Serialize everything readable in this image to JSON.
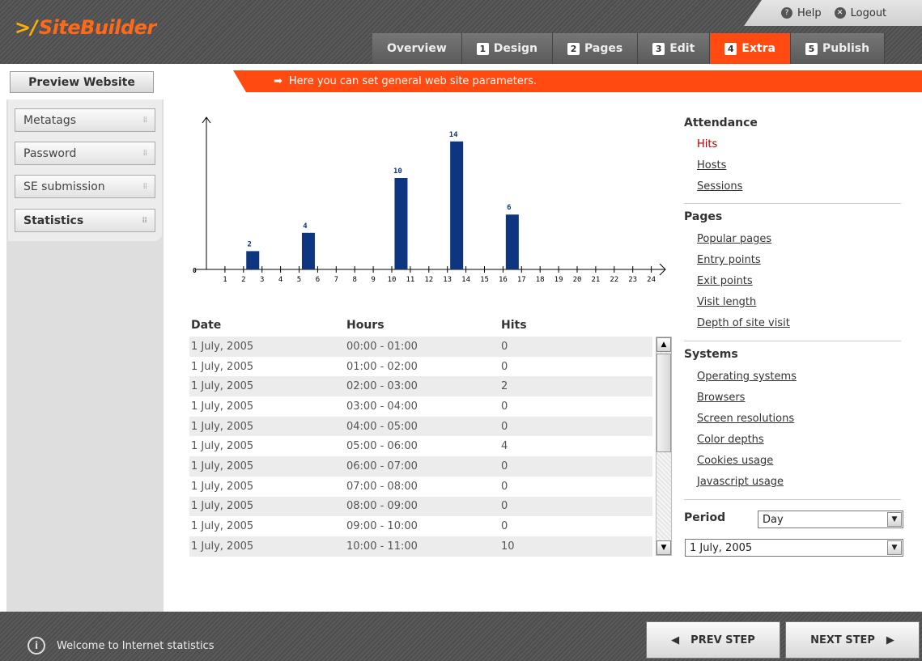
{
  "app": {
    "logo": "SiteBuilder"
  },
  "toplinks": {
    "help": "Help",
    "logout": "Logout"
  },
  "tabs": [
    {
      "num": "",
      "label": "Overview"
    },
    {
      "num": "1",
      "label": "Design"
    },
    {
      "num": "2",
      "label": "Pages"
    },
    {
      "num": "3",
      "label": "Edit"
    },
    {
      "num": "4",
      "label": "Extra"
    },
    {
      "num": "5",
      "label": "Publish"
    }
  ],
  "active_tab": "Extra",
  "preview_label": "Preview Website",
  "hint": "Here you can set general web site parameters.",
  "nav": [
    {
      "label": "Metatags"
    },
    {
      "label": "Password"
    },
    {
      "label": "SE submission"
    },
    {
      "label": "Statistics"
    }
  ],
  "chart_data": {
    "type": "bar",
    "x": [
      1,
      2,
      3,
      4,
      5,
      6,
      7,
      8,
      9,
      10,
      11,
      12,
      13,
      14,
      15,
      16,
      17,
      18,
      19,
      20,
      21,
      22,
      23,
      24
    ],
    "origin_label": "0",
    "bars": [
      {
        "x": 2.5,
        "value": 2
      },
      {
        "x": 5.5,
        "value": 4
      },
      {
        "x": 10.5,
        "value": 10
      },
      {
        "x": 13.5,
        "value": 14
      },
      {
        "x": 16.5,
        "value": 6
      }
    ],
    "color": "#0d3580"
  },
  "table": {
    "headers": {
      "date": "Date",
      "hours": "Hours",
      "hits": "Hits"
    },
    "rows": [
      {
        "date": "1 July, 2005",
        "hours": "00:00 - 01:00",
        "hits": "0"
      },
      {
        "date": "1 July, 2005",
        "hours": "01:00 - 02:00",
        "hits": "0"
      },
      {
        "date": "1 July, 2005",
        "hours": "02:00 - 03:00",
        "hits": "2"
      },
      {
        "date": "1 July, 2005",
        "hours": "03:00 - 04:00",
        "hits": "0"
      },
      {
        "date": "1 July, 2005",
        "hours": "04:00 - 05:00",
        "hits": "0"
      },
      {
        "date": "1 July, 2005",
        "hours": "05:00 - 06:00",
        "hits": "4"
      },
      {
        "date": "1 July, 2005",
        "hours": "06:00 - 07:00",
        "hits": "0"
      },
      {
        "date": "1 July, 2005",
        "hours": "07:00 - 08:00",
        "hits": "0"
      },
      {
        "date": "1 July, 2005",
        "hours": "08:00 - 09:00",
        "hits": "0"
      },
      {
        "date": "1 July, 2005",
        "hours": "09:00 - 10:00",
        "hits": "0"
      },
      {
        "date": "1 July, 2005",
        "hours": "10:00 - 11:00",
        "hits": "10"
      }
    ]
  },
  "right": {
    "attendance": {
      "title": "Attendance",
      "links": [
        "Hits",
        "Hosts",
        "Sessions"
      ]
    },
    "pages": {
      "title": "Pages",
      "links": [
        "Popular pages",
        "Entry points",
        "Exit points",
        "Visit length",
        "Depth of site visit"
      ]
    },
    "systems": {
      "title": "Systems",
      "links": [
        "Operating systems",
        "Browsers",
        "Screen resolutions",
        "Color depths",
        "Cookies usage",
        "Javascript usage"
      ]
    },
    "period_label": "Period",
    "period_value": "Day",
    "date_value": "1 July, 2005"
  },
  "footer": {
    "status": "Welcome to Internet statistics",
    "prev": "PREV STEP",
    "next": "NEXT STEP"
  }
}
